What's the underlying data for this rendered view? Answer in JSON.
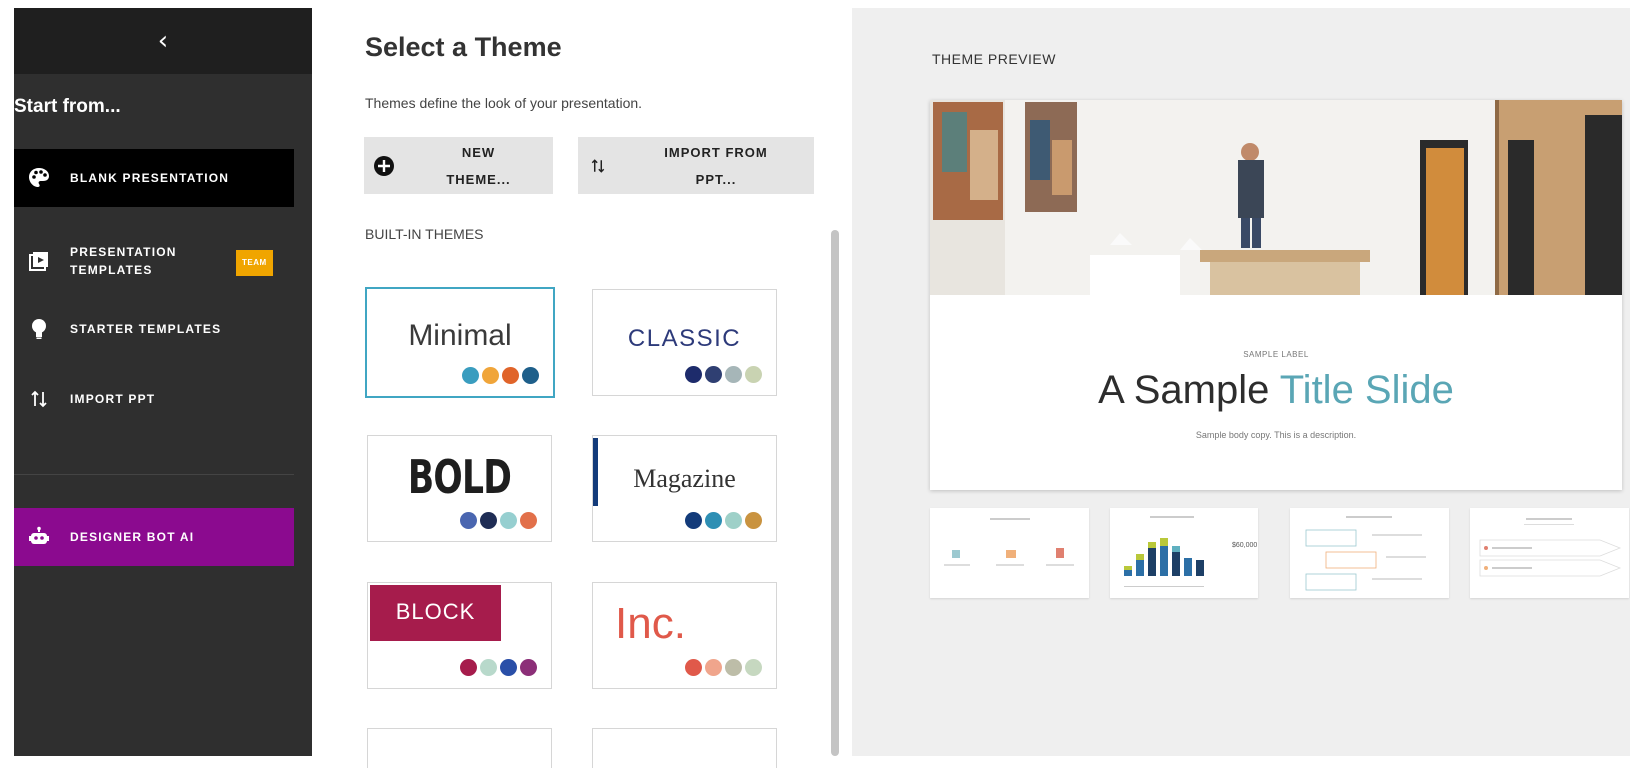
{
  "sidebar": {
    "back_icon": "chevron-left-icon",
    "heading": "Start from...",
    "items": [
      {
        "label": "BLANK PRESENTATION",
        "icon": "palette-icon",
        "active": true
      },
      {
        "label_line1": "PRESENTATION",
        "label_line2": "TEMPLATES",
        "icon": "template-play-icon",
        "badge": "TEAM"
      },
      {
        "label": "STARTER TEMPLATES",
        "icon": "lightbulb-icon"
      },
      {
        "label": "IMPORT PPT",
        "icon": "import-arrows-icon"
      },
      {
        "label": "DESIGNER BOT AI",
        "icon": "robot-icon",
        "accent": "#8b0a8f"
      }
    ]
  },
  "main": {
    "title": "Select a Theme",
    "subtitle": "Themes define the look of your presentation.",
    "buttons": {
      "new_theme_line1": "NEW",
      "new_theme_line2": "THEME...",
      "import_line1": "IMPORT FROM",
      "import_line2": "PPT..."
    },
    "section_label": "BUILT-IN THEMES",
    "themes": [
      {
        "name": "Minimal",
        "selected": true,
        "colors": [
          "#3a9dbf",
          "#f0a53a",
          "#e0642a",
          "#1e5f8a"
        ]
      },
      {
        "name": "CLASSIC",
        "colors": [
          "#1d2b6b",
          "#2f3f72",
          "#a6b6b8",
          "#c9d3b2"
        ]
      },
      {
        "name": "BOLD",
        "colors": [
          "#4a66b0",
          "#1f2d55",
          "#96cfd0",
          "#e2704a"
        ]
      },
      {
        "name": "Magazine",
        "colors": [
          "#133b7a",
          "#2e8fb4",
          "#9ed0c8",
          "#c99340"
        ]
      },
      {
        "name": "BLOCK",
        "colors": [
          "#a61c4c",
          "#b8d9cb",
          "#2a4fa8",
          "#8c2f78"
        ]
      },
      {
        "name": "Inc.",
        "colors": [
          "#e0594a",
          "#f0a58c",
          "#bdbda8",
          "#c6d8c0"
        ]
      }
    ]
  },
  "preview": {
    "label": "THEME PREVIEW",
    "slide": {
      "label": "SAMPLE LABEL",
      "title_main": "A Sample ",
      "title_accent": "Title Slide",
      "body": "Sample body copy. This is a description."
    },
    "thumb_chart_value": "$60,000"
  },
  "colors": {
    "sidebar_bg": "#2f2f2f",
    "accent_teal": "#5aa6b5",
    "bot_purple": "#8b0a8f",
    "selected_border": "#40a6c3"
  }
}
